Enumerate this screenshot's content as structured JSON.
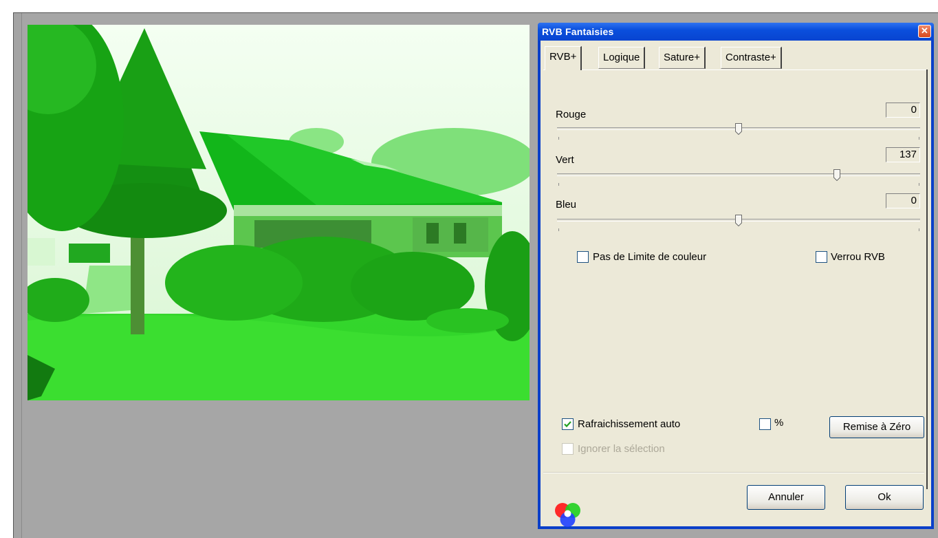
{
  "dialog": {
    "title": "RVB Fantaisies",
    "close_glyph": "✕",
    "tabs": [
      "RVB+",
      "Logique",
      "Sature+",
      "Contraste+"
    ],
    "active_tab": "RVB+",
    "sliders": [
      {
        "label": "Rouge",
        "value": "0",
        "position": 0.5
      },
      {
        "label": "Vert",
        "value": "137",
        "position": 0.77
      },
      {
        "label": "Bleu",
        "value": "0",
        "position": 0.5
      }
    ],
    "checkboxes": {
      "no_color_limit": {
        "label": "Pas de Limite de couleur",
        "checked": false
      },
      "rgb_lock": {
        "label": "Verrou RVB",
        "checked": false
      },
      "auto_refresh": {
        "label": "Rafraichissement auto",
        "checked": true
      },
      "percent": {
        "label": "%",
        "checked": false
      },
      "ignore_selection": {
        "label": "Ignorer la sélection",
        "checked": false,
        "disabled": true
      }
    },
    "buttons": {
      "reset": "Remise à Zéro",
      "cancel": "Annuler",
      "ok": "Ok"
    },
    "logo_icon": "rgb-circles-icon"
  },
  "colors": {
    "titlebar": "#0a4fdd",
    "dialog_bg": "#ece9d8",
    "canvas_bg": "#a6a6a6",
    "image_tint": "#2cd42c"
  }
}
